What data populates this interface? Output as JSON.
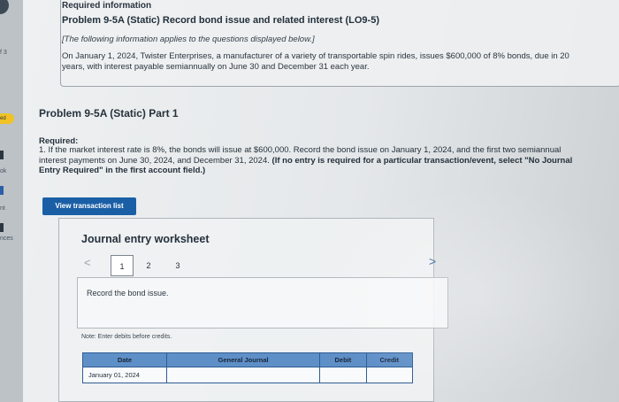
{
  "header": {
    "required_info": "Required information",
    "problem_title": "Problem 9-5A (Static) Record bond issue and related interest (LO9-5)",
    "applies_note": "[The following information applies to the questions displayed below.]",
    "scenario": "On January 1, 2024, Twister Enterprises, a manufacturer of a variety of transportable spin rides, issues $600,000 of 8% bonds, due in 20 years, with interest payable semiannually on June 30 and December 31 each year."
  },
  "part": {
    "title": "Problem 9-5A (Static) Part 1",
    "required_label": "Required:",
    "required_text": "1. If the market interest rate is 8%, the bonds will issue at $600,000. Record the bond issue on January 1, 2024, and the first two semiannual interest payments on June 30, 2024, and December 31, 2024.",
    "required_bold": "(If no entry is required for a particular transaction/event, select \"No Journal Entry Required\" in the first account field.)"
  },
  "buttons": {
    "view_transactions": "View transaction list"
  },
  "worksheet": {
    "title": "Journal entry worksheet",
    "prev": "<",
    "next": ">",
    "steps": [
      "1",
      "2",
      "3"
    ],
    "prompt": "Record the bond issue.",
    "note": "Note: Enter debits before credits.",
    "columns": [
      "Date",
      "General Journal",
      "Debit",
      "Credit"
    ],
    "rows": [
      {
        "date": "January 01, 2024",
        "account": "",
        "debit": "",
        "credit": ""
      }
    ]
  },
  "sidebar": {
    "labels": [
      "f 3",
      "ed",
      "ok",
      "nt",
      "nces"
    ]
  }
}
